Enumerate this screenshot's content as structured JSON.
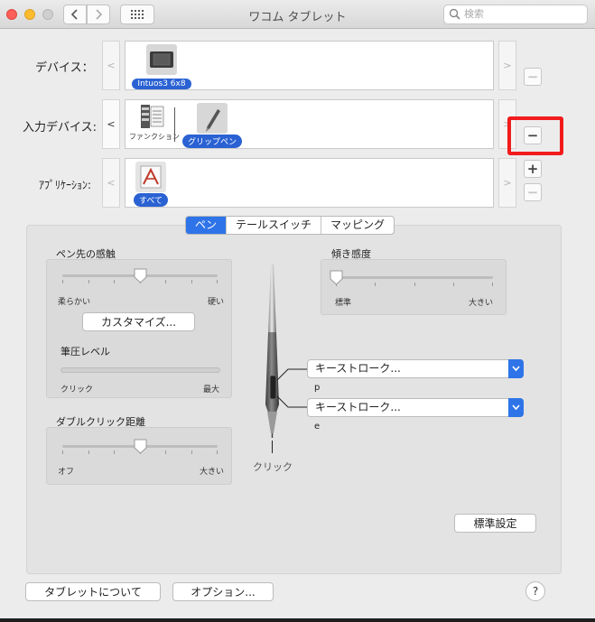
{
  "window": {
    "title": "ワコム タブレット"
  },
  "search": {
    "placeholder": "検索"
  },
  "rows": {
    "device_label": "デバイス：",
    "input_label": "入力デバイス:",
    "app_label": "ｱﾌﾟﾘｹｰｼｮﾝ:"
  },
  "devices": [
    {
      "label": "Intuos3 6x8",
      "selected": true
    }
  ],
  "input_devices": [
    {
      "label": "ファンクション",
      "selected": false
    },
    {
      "label": "グリップペン",
      "selected": true
    }
  ],
  "applications": [
    {
      "label": "すべて",
      "selected": true
    }
  ],
  "arrows": {
    "left": "<",
    "right": ">"
  },
  "buttons": {
    "minus": "−",
    "plus": "+"
  },
  "tabs": [
    {
      "label": "ペン",
      "selected": true
    },
    {
      "label": "テールスイッチ",
      "selected": false
    },
    {
      "label": "マッピング",
      "selected": false
    }
  ],
  "tip_feel": {
    "title": "ペン先の感触",
    "min": "柔らかい",
    "max": "硬い",
    "value": 0.5,
    "customize": "カスタマイズ..."
  },
  "pressure": {
    "title": "筆圧レベル",
    "min": "クリック",
    "max": "最大",
    "level": 0
  },
  "double_click": {
    "title": "ダブルクリック距離",
    "min": "オフ",
    "max": "大きい",
    "value": 0.5
  },
  "tilt": {
    "title": "傾き感度",
    "min": "標準",
    "max": "大きい",
    "value": 0
  },
  "pen": {
    "upper_button": {
      "value": "キーストローク...",
      "sub": "p"
    },
    "lower_button": {
      "value": "キーストローク...",
      "sub": "e"
    },
    "tip_label": "クリック"
  },
  "defaults_button": "標準設定",
  "footer": {
    "about": "タブレットについて",
    "options": "オプション...",
    "help": "?"
  },
  "colors": {
    "accent": "#2e74e8",
    "selection": "#2a62d3",
    "annotation": "#f21c1c"
  }
}
